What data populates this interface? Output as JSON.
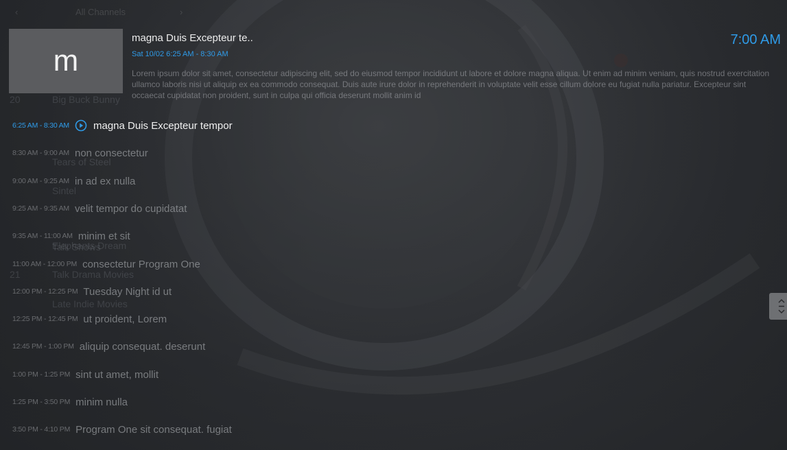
{
  "ghost_list": {
    "header_label": "All Channels",
    "left_arrow": "‹",
    "right_arrow": "›",
    "rows": [
      {
        "num": "20",
        "name": "Big Buck Bunny"
      },
      {
        "num": "",
        "name": "Tears of Steel"
      },
      {
        "num": "",
        "name": "Sintel"
      },
      {
        "num": "",
        "name": "Elephants Dream"
      },
      {
        "num": "",
        "name": "Talk Shows"
      },
      {
        "num": "21",
        "name": "Talk Drama Movies"
      },
      {
        "num": "",
        "name": "Late Indie Movies"
      }
    ]
  },
  "program_info": {
    "thumbnail_letter": "m",
    "title": "magna Duis Excepteur te..",
    "time_line": "Sat 10/02  6:25 AM - 8:30 AM",
    "description": "Lorem ipsum dolor sit amet, consectetur adipiscing elit, sed do eiusmod tempor incididunt ut labore et dolore magna aliqua. Ut enim ad minim veniam, quis nostrud exercitation ullamco laboris nisi ut aliquip ex ea commodo consequat. Duis aute irure dolor in reprehenderit in voluptate velit esse cillum dolore eu fugiat nulla pariatur. Excepteur sint occaecat cupidatat non proident, sunt in culpa qui officia deserunt mollit anim id"
  },
  "clock": "7:00 AM",
  "schedule": [
    {
      "time": "6:25 AM - 8:30 AM",
      "name": "magna Duis Excepteur tempor",
      "current": true
    },
    {
      "time": "8:30 AM - 9:00 AM",
      "name": "non consectetur",
      "current": false
    },
    {
      "time": "9:00 AM - 9:25 AM",
      "name": "in ad ex nulla",
      "current": false
    },
    {
      "time": "9:25 AM - 9:35 AM",
      "name": "velit tempor do cupidatat",
      "current": false
    },
    {
      "time": "9:35 AM - 11:00 AM",
      "name": "minim et sit",
      "current": false
    },
    {
      "time": "11:00 AM - 12:00 PM",
      "name": "consectetur Program One",
      "current": false
    },
    {
      "time": "12:00 PM - 12:25 PM",
      "name": "Tuesday Night id ut",
      "current": false
    },
    {
      "time": "12:25 PM - 12:45 PM",
      "name": "ut proident, Lorem",
      "current": false
    },
    {
      "time": "12:45 PM - 1:00 PM",
      "name": "aliquip consequat. deserunt",
      "current": false
    },
    {
      "time": "1:00 PM - 1:25 PM",
      "name": "sint ut amet, mollit",
      "current": false
    },
    {
      "time": "1:25 PM - 3:50 PM",
      "name": "minim nulla",
      "current": false
    },
    {
      "time": "3:50 PM - 4:10 PM",
      "name": "Program One sit consequat. fugiat",
      "current": false
    }
  ],
  "icons": {
    "play": "play-circle-icon",
    "scroll": "scroll-handle-icon"
  },
  "colors": {
    "accent": "#2f9be8",
    "thumbnail_bg": "#5b5c5f"
  }
}
